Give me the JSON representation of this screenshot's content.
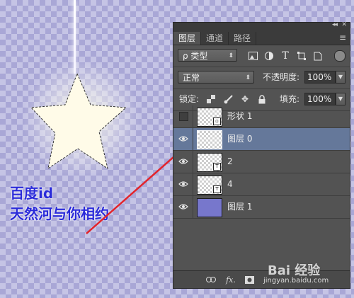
{
  "panel": {
    "tabs": [
      {
        "label": "图层"
      },
      {
        "label": "通道"
      },
      {
        "label": "路径"
      }
    ],
    "collapse_glyph": "◂◂",
    "close_glyph": "✕",
    "menu_glyph": "≡",
    "filter": {
      "label": "ρ 类型"
    },
    "blend_mode": {
      "value": "正常"
    },
    "opacity": {
      "label": "不透明度:",
      "value": "100%"
    },
    "lock": {
      "label": "锁定:"
    },
    "fill": {
      "label": "填充:",
      "value": "100%"
    },
    "layers": [
      {
        "name": "形状 1",
        "visible": false,
        "selected": false,
        "thumb": "checker",
        "badge": "▫"
      },
      {
        "name": "图层 0",
        "visible": true,
        "selected": true,
        "thumb": "checker",
        "badge": ""
      },
      {
        "name": "2",
        "visible": true,
        "selected": false,
        "thumb": "checker",
        "badge": "T"
      },
      {
        "name": "4",
        "visible": true,
        "selected": false,
        "thumb": "checker",
        "badge": "T"
      },
      {
        "name": "图层 1",
        "visible": true,
        "selected": false,
        "thumb": "solid",
        "badge": ""
      }
    ],
    "bottom_icons": [
      "link-icon",
      "fx-icon",
      "mask-icon"
    ],
    "bottom_fx": "fx."
  },
  "canvas": {
    "text_line1": "百度id",
    "text_line2": "天然河与你相约"
  },
  "watermark": {
    "logo": "Bai 经验",
    "url": "jingyan.baidu.com"
  },
  "colors": {
    "panel_bg": "#535353",
    "selected_layer": "#65789a",
    "canvas_text": "#2b2bd9",
    "arrow": "#e3242b",
    "solid_layer": "#7777cc"
  }
}
